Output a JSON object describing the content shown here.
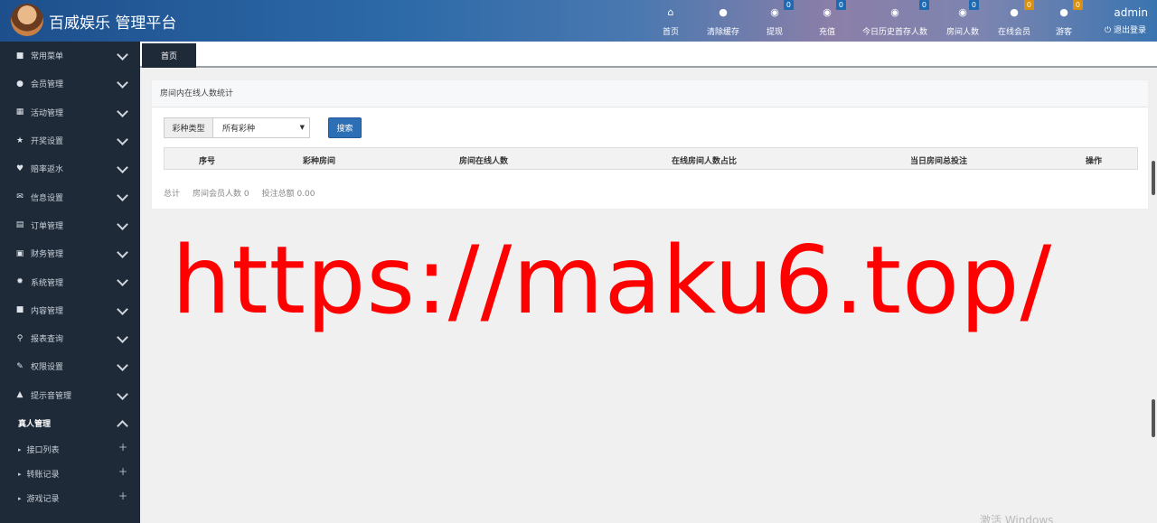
{
  "header": {
    "brand": "百威娱乐 管理平台",
    "nav": [
      {
        "label": "首页",
        "icon": "home-icon",
        "badge": null
      },
      {
        "label": "清除缓存",
        "icon": "clear-cache-icon",
        "badge": null
      },
      {
        "label": "提现",
        "icon": "withdraw-icon",
        "badge": "0",
        "badge_color": "#1e6ab0"
      },
      {
        "label": "充值",
        "icon": "recharge-icon",
        "badge": "0",
        "badge_color": "#1e6ab0"
      },
      {
        "label": "今日历史首存人数",
        "icon": "first-deposit-icon",
        "badge": "0",
        "badge_color": "#1e6ab0"
      },
      {
        "label": "房间人数",
        "icon": "room-count-icon",
        "badge": "0",
        "badge_color": "#1e6ab0"
      },
      {
        "label": "在线会员",
        "icon": "online-member-icon",
        "badge": "0",
        "badge_color": "#d98f10"
      },
      {
        "label": "游客",
        "icon": "guest-icon",
        "badge": "0",
        "badge_color": "#d98f10"
      }
    ],
    "user": "admin",
    "logout": "⏻ 退出登录"
  },
  "sidebar": {
    "items": [
      {
        "label": "常用菜单",
        "icon": "grid-icon"
      },
      {
        "label": "会员管理",
        "icon": "member-icon"
      },
      {
        "label": "活动管理",
        "icon": "calendar-icon"
      },
      {
        "label": "开奖设置",
        "icon": "star-icon"
      },
      {
        "label": "赔率返水",
        "icon": "heart-icon"
      },
      {
        "label": "信息设置",
        "icon": "mail-icon"
      },
      {
        "label": "订单管理",
        "icon": "order-icon"
      },
      {
        "label": "财务管理",
        "icon": "finance-icon"
      },
      {
        "label": "系统管理",
        "icon": "settings-icon"
      },
      {
        "label": "内容管理",
        "icon": "content-icon"
      },
      {
        "label": "报表查询",
        "icon": "search-icon"
      },
      {
        "label": "权限设置",
        "icon": "wrench-icon"
      },
      {
        "label": "提示音管理",
        "icon": "bell-icon"
      }
    ],
    "open_group": "真人管理",
    "sub_items": [
      "接口列表",
      "转账记录",
      "游戏记录"
    ]
  },
  "tabs": [
    {
      "label": "首页"
    }
  ],
  "panel": {
    "title": "房间内在线人数统计",
    "filter_label": "彩种类型",
    "filter_value": "所有彩种",
    "search_label": "搜索",
    "columns": [
      "序号",
      "彩种房间",
      "房间在线人数",
      "在线房间人数占比",
      "当日房间总投注",
      "操作"
    ],
    "summary": [
      "总计",
      "房间会员人数 0",
      "投注总额 0.00"
    ]
  },
  "overlay": {
    "url": "https://maku6.top/"
  },
  "os_watermark": "激活 Windows",
  "colors": {
    "sidebar_bg": "#1f2a38",
    "primary_button": "#2d6fb5",
    "overlay_text": "#ff0000"
  }
}
